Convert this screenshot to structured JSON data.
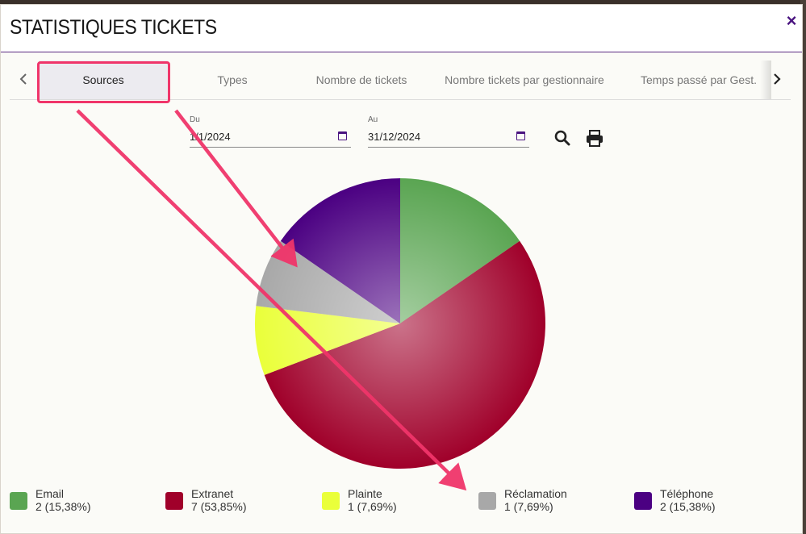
{
  "modal": {
    "title": "STATISTIQUES TICKETS",
    "close_label": "×"
  },
  "tabs": [
    {
      "label": "Sources",
      "active": true
    },
    {
      "label": "Types",
      "active": false
    },
    {
      "label": "Nombre de tickets",
      "active": false
    },
    {
      "label": "Nombre tickets par gestionnaire",
      "active": false
    },
    {
      "label": "Temps passé par Gest.",
      "active": false
    }
  ],
  "filters": {
    "from_label": "Du",
    "from_value": "1/1/2024",
    "to_label": "Au",
    "to_value": "31/12/2024"
  },
  "icons": {
    "prev": "chevron-left-icon",
    "next": "chevron-right-icon",
    "search": "search-icon",
    "print": "print-icon",
    "calendar": "calendar-icon"
  },
  "legend": [
    {
      "name": "Email",
      "value": "2 (15,38%)",
      "color": "#5aa552"
    },
    {
      "name": "Extranet",
      "value": "7 (53,85%)",
      "color": "#a0002a"
    },
    {
      "name": "Plainte",
      "value": "1 (7,69%)",
      "color": "#eaff3a"
    },
    {
      "name": "Réclamation",
      "value": "1 (7,69%)",
      "color": "#a8a8a8"
    },
    {
      "name": "Téléphone",
      "value": "2 (15,38%)",
      "color": "#4b0082"
    }
  ],
  "chart_data": {
    "type": "pie",
    "categories": [
      "Email",
      "Extranet",
      "Plainte",
      "Réclamation",
      "Téléphone"
    ],
    "values": [
      2,
      7,
      1,
      1,
      2
    ],
    "percent_labels": [
      "15,38%",
      "53,85%",
      "7,69%",
      "7,69%",
      "15,38%"
    ],
    "colors": [
      "#5aa552",
      "#a0002a",
      "#eaff3a",
      "#a8a8a8",
      "#4b0082"
    ],
    "legend_position": "bottom"
  },
  "annotation": {
    "highlight_color": "#f0356a"
  }
}
